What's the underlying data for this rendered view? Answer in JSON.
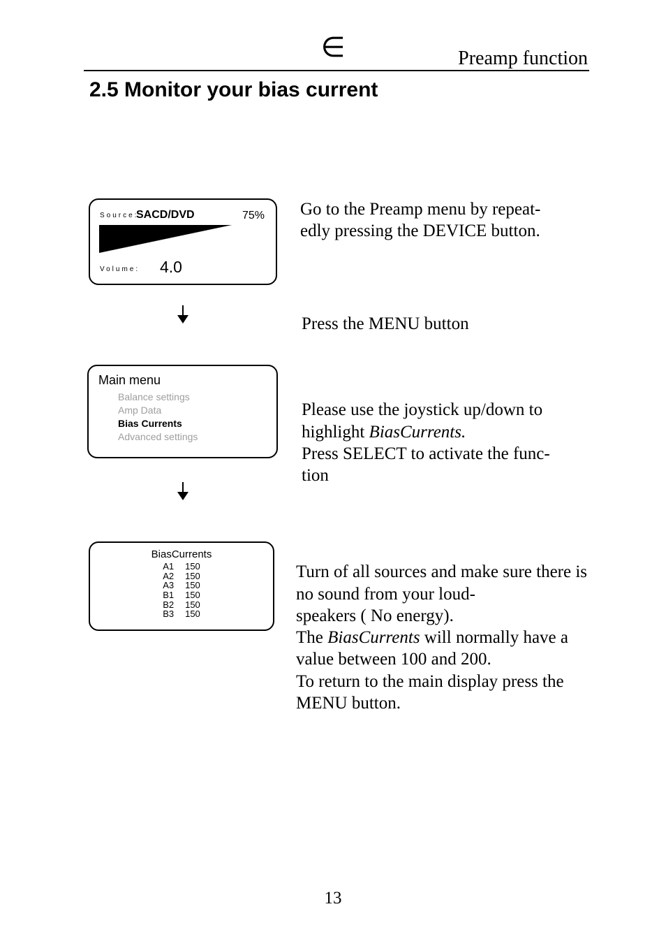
{
  "header": {
    "page_label": "Preamp function",
    "section_title": "2.5 Monitor your bias current",
    "logo_symbol": "∈"
  },
  "page_number": "13",
  "steps": {
    "step1": "Go to the Preamp menu by       repeat-\nedly pressing the DEVICE    button.",
    "step2": "Press the MENU button",
    "step3_a": "Please use the joystick up/down to highlight ",
    "step3_em": "BiasCurrents.",
    "step3_b": "\nPress SELECT to activate the func-\ntion",
    "step4_a": "Turn of all sources and make sure there is no sound from your loud-\nspeakers ( No energy).\nThe ",
    "step4_em": "BiasCurrents",
    "step4_b": " will normally have a value  between 100 and 200.\nTo return to the main display press the MENU button."
  },
  "screen1": {
    "source_label": "Source:",
    "source_value": "SACD/DVD",
    "percent": "75%",
    "volume_label": "Volume:",
    "volume_value": "4.0"
  },
  "screen2": {
    "title": "Main menu",
    "items": [
      {
        "label": "Balance settings",
        "selected": false
      },
      {
        "label": "Amp Data",
        "selected": false
      },
      {
        "label": "Bias Currents",
        "selected": true
      },
      {
        "label": "Advanced settings",
        "selected": false
      }
    ]
  },
  "screen3": {
    "title": "BiasCurrents",
    "rows": [
      {
        "ch": "A1",
        "val": "150"
      },
      {
        "ch": "A2",
        "val": "150"
      },
      {
        "ch": "A3",
        "val": "150"
      },
      {
        "ch": "B1",
        "val": "150"
      },
      {
        "ch": "B2",
        "val": "150"
      },
      {
        "ch": "B3",
        "val": "150"
      }
    ]
  }
}
